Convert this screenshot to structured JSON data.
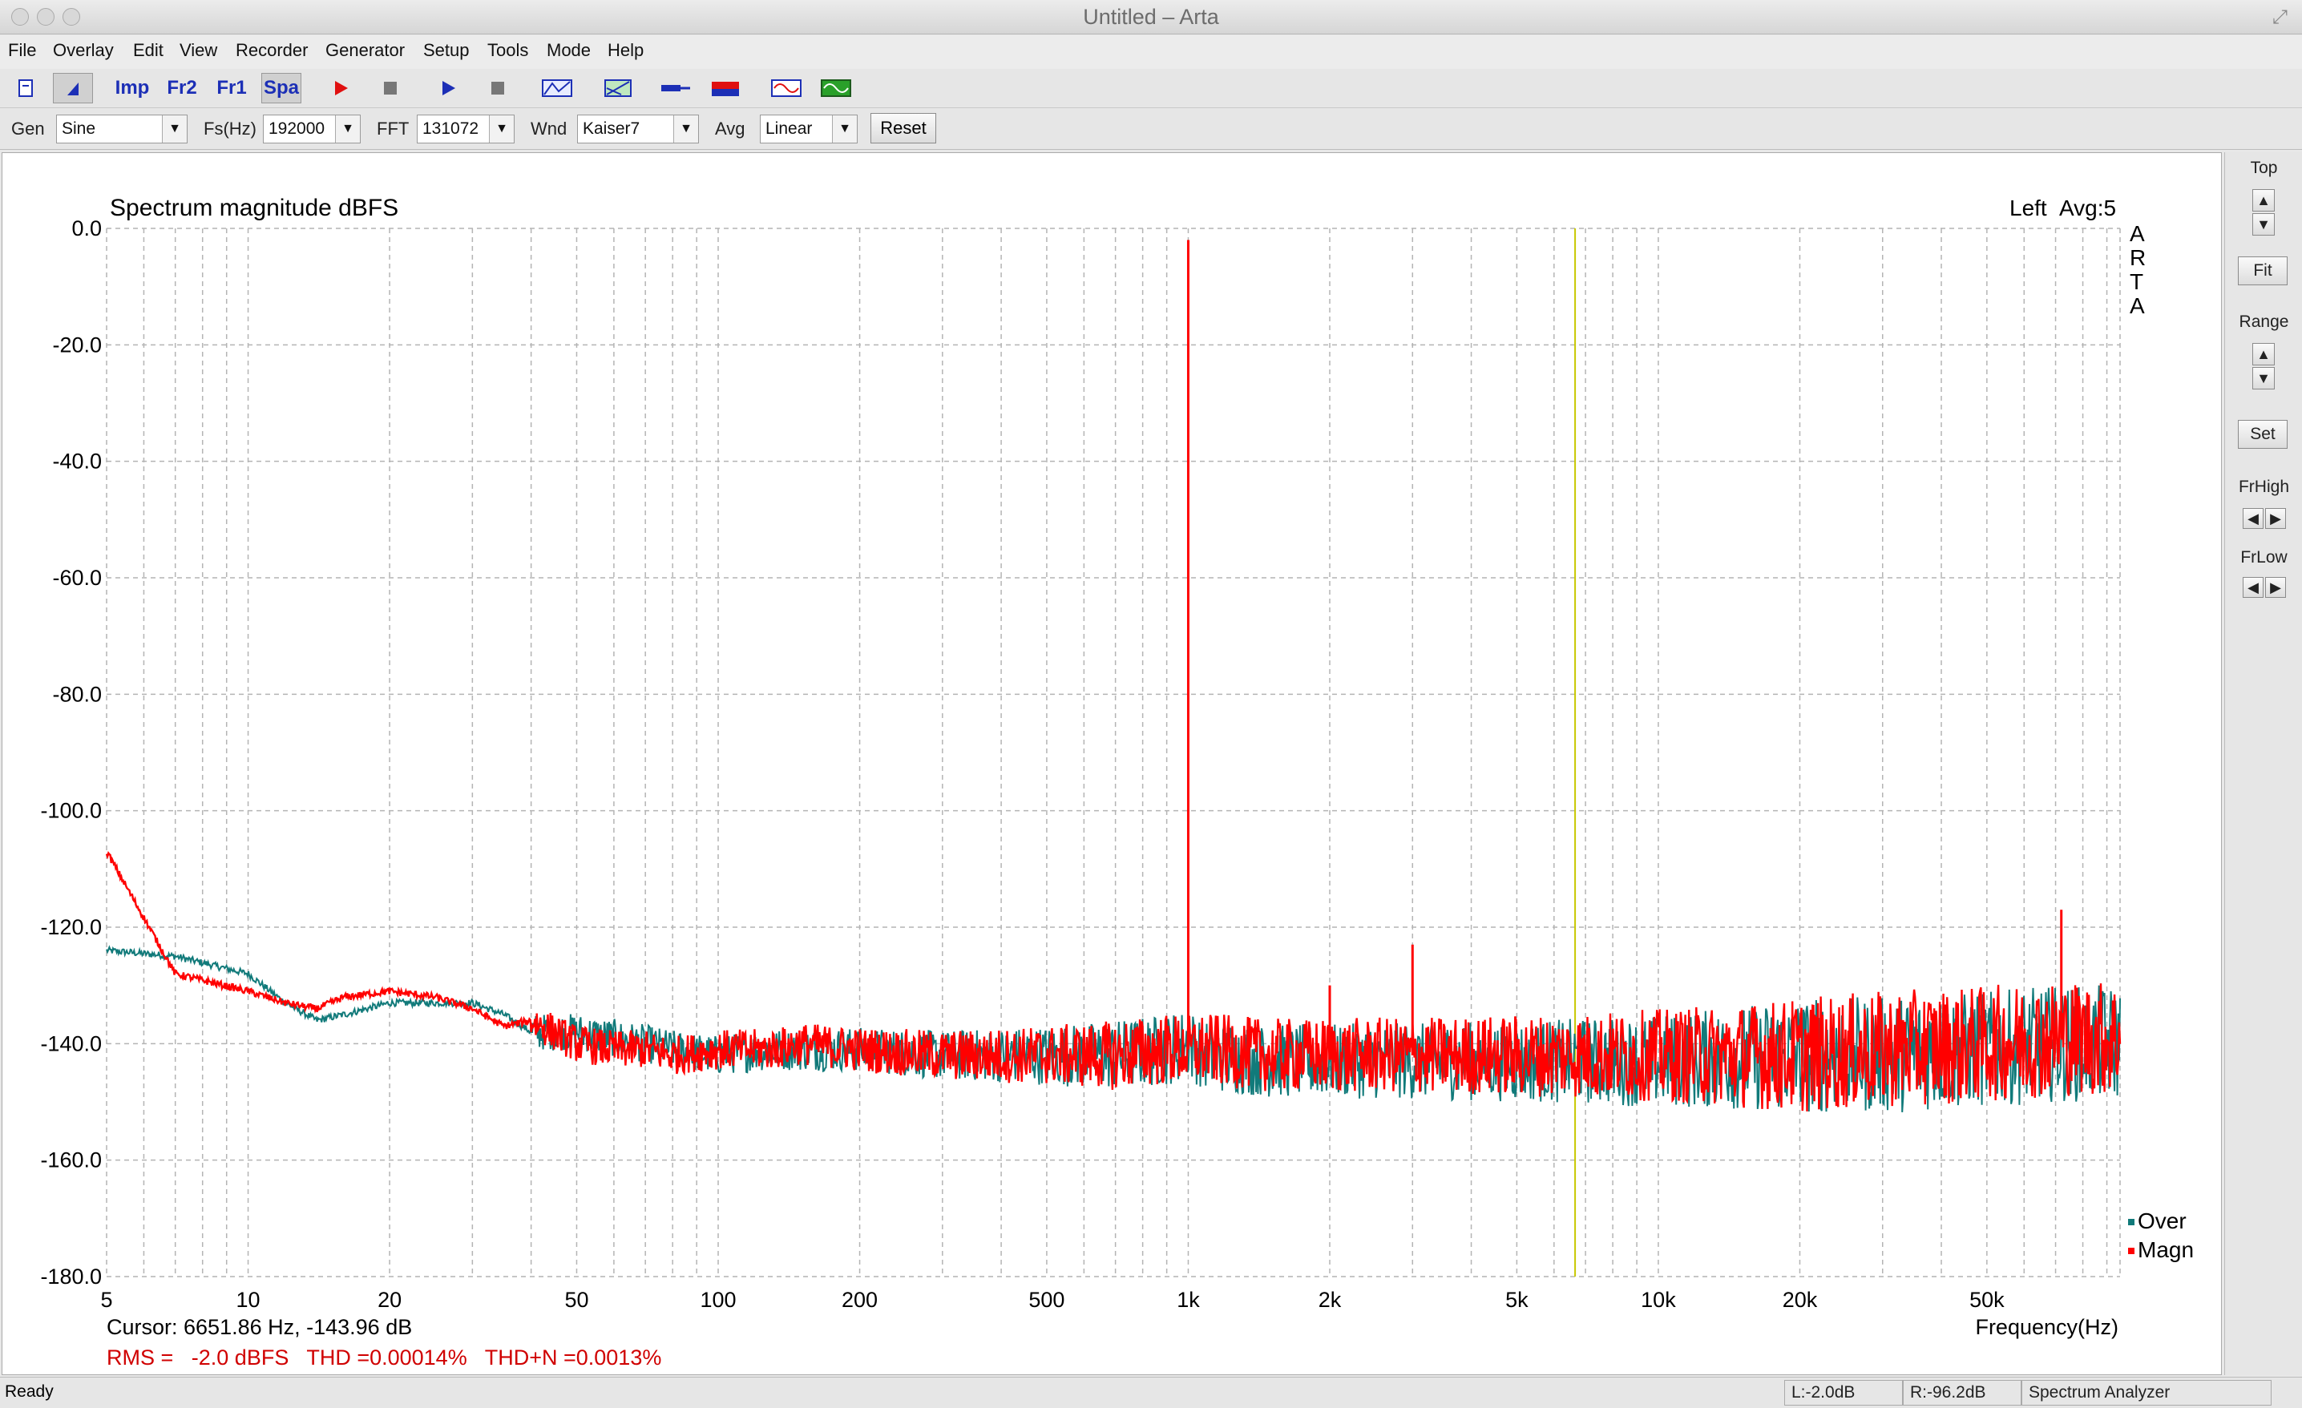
{
  "window": {
    "title": "Untitled – Arta"
  },
  "menu": [
    "File",
    "Overlay",
    "Edit",
    "View",
    "Recorder",
    "Generator",
    "Setup",
    "Tools",
    "Mode",
    "Help"
  ],
  "toolbar": {
    "imp_label": "Imp",
    "fr2_label": "Fr2",
    "fr1_label": "Fr1",
    "spa_label": "Spa",
    "icons": [
      "new-file-icon",
      "overlay-icon",
      "imp-mode",
      "fr2-mode",
      "fr1-mode",
      "spa-mode",
      "record-icon",
      "stop-icon",
      "play-icon",
      "stop-icon",
      "abc-icon",
      "chart-icon",
      "probe-icon",
      "color-icon",
      "scope-icon",
      "generator-icon"
    ]
  },
  "params": {
    "gen_label": "Gen",
    "gen_value": "Sine",
    "fs_label": "Fs(Hz)",
    "fs_value": "192000",
    "fft_label": "FFT",
    "fft_value": "131072",
    "wnd_label": "Wnd",
    "wnd_value": "Kaiser7",
    "avg_label": "Avg",
    "avg_value": "Linear",
    "reset_label": "Reset"
  },
  "plot_info": {
    "channel": "Left",
    "avg": "Avg:5",
    "watermark": [
      "A",
      "R",
      "T",
      "A"
    ],
    "cursor": "Cursor: 6651.86 Hz, -143.96 dB",
    "metrics": "RMS =   -2.0 dBFS   THD =0.00014%   THD+N =0.0013%"
  },
  "chart_data": {
    "type": "line",
    "title": "Spectrum magnitude dBFS",
    "xlabel": "Frequency(Hz)",
    "ylabel": "",
    "xscale": "log",
    "xlim": [
      5,
      96000
    ],
    "ylim": [
      -180,
      0
    ],
    "grid": true,
    "legend_position": "bottom-right",
    "x_ticks": [
      5,
      10,
      20,
      50,
      100,
      200,
      500,
      1000,
      2000,
      5000,
      10000,
      20000,
      50000
    ],
    "x_tick_labels": [
      "5",
      "10",
      "20",
      "50",
      "100",
      "200",
      "500",
      "1k",
      "2k",
      "5k",
      "10k",
      "20k",
      "50k"
    ],
    "y_ticks": [
      0,
      -20,
      -40,
      -60,
      -80,
      -100,
      -120,
      -140,
      -160,
      -180
    ],
    "y_tick_labels": [
      "0.0",
      "-20.0",
      "-40.0",
      "-60.0",
      "-80.0",
      "-100.0",
      "-120.0",
      "-140.0",
      "-160.0",
      "-180.0"
    ],
    "cursor_freq": 6651.86,
    "series": [
      {
        "name": "Over",
        "color": "#117a7a",
        "x": [
          5,
          7,
          10,
          12,
          14,
          16,
          20,
          25,
          30,
          35,
          40,
          50,
          60,
          70,
          80,
          100,
          130,
          150,
          200,
          300,
          500,
          700,
          900,
          1000,
          1100,
          1500,
          2000,
          3000,
          5000,
          7000,
          10000,
          20000,
          30000,
          50000,
          70000,
          96000
        ],
        "y": [
          -124,
          -125,
          -128,
          -133,
          -136,
          -135,
          -133,
          -133,
          -133,
          -135,
          -138,
          -138,
          -139,
          -140,
          -141,
          -142,
          -141,
          -141,
          -141,
          -142,
          -142,
          -142,
          -141,
          -140,
          -142,
          -143,
          -143,
          -143,
          -143,
          -143,
          -143,
          -142,
          -142,
          -141,
          -140,
          -140
        ]
      },
      {
        "name": "Magn",
        "color": "#ff0000",
        "x": [
          5,
          7,
          10,
          12,
          14,
          16,
          20,
          25,
          30,
          35,
          40,
          50,
          60,
          70,
          80,
          100,
          130,
          150,
          200,
          300,
          500,
          700,
          900,
          1000,
          1100,
          1500,
          2000,
          3000,
          5000,
          7000,
          10000,
          20000,
          30000,
          50000,
          70000,
          96000
        ],
        "y": [
          -107,
          -128,
          -131,
          -133,
          -134,
          -132,
          -131,
          -132,
          -134,
          -137,
          -136,
          -140,
          -141,
          -141,
          -142,
          -141,
          -141,
          -140,
          -141,
          -142,
          -142,
          -142,
          -141,
          -2,
          -141,
          -142,
          -142,
          -142,
          -142,
          -142,
          -142,
          -142,
          -141,
          -140,
          -139,
          -139
        ],
        "peaks": [
          {
            "x": 1000,
            "y": -2
          },
          {
            "x": 2000,
            "y": -130
          },
          {
            "x": 3000,
            "y": -123
          },
          {
            "x": 72000,
            "y": -117
          }
        ]
      }
    ]
  },
  "right_panel": {
    "top_label": "Top",
    "fit_label": "Fit",
    "range_label": "Range",
    "set_label": "Set",
    "frhigh_label": "FrHigh",
    "frlow_label": "FrLow"
  },
  "status": {
    "ready": "Ready",
    "left_level": "L:-2.0dB",
    "right_level": "R:-96.2dB",
    "mode": "Spectrum Analyzer"
  }
}
